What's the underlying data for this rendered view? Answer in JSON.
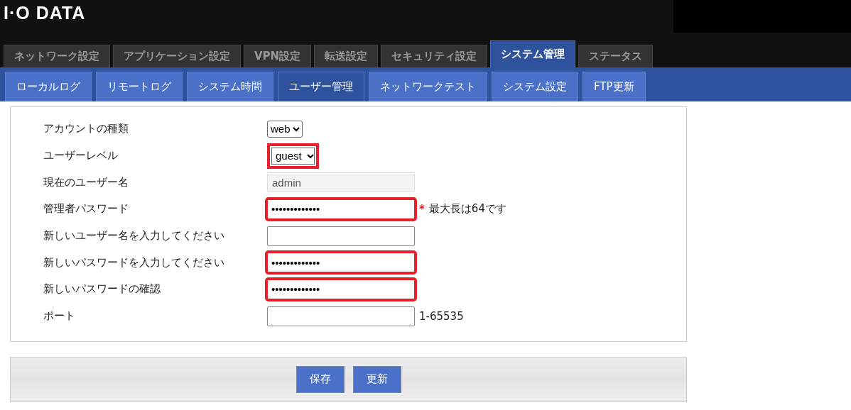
{
  "header": {
    "logo": "I·O DATA"
  },
  "tabs": [
    {
      "label": "ネットワーク設定",
      "selected": false
    },
    {
      "label": "アプリケーション設定",
      "selected": false
    },
    {
      "label": "VPN設定",
      "selected": false
    },
    {
      "label": "転送設定",
      "selected": false
    },
    {
      "label": "セキュリティ設定",
      "selected": false
    },
    {
      "label": "システム管理",
      "selected": true
    },
    {
      "label": "ステータス",
      "selected": false
    }
  ],
  "subtabs": [
    {
      "label": "ローカルログ",
      "selected": false
    },
    {
      "label": "リモートログ",
      "selected": false
    },
    {
      "label": "システム時間",
      "selected": false
    },
    {
      "label": "ユーザー管理",
      "selected": true
    },
    {
      "label": "ネットワークテスト",
      "selected": false
    },
    {
      "label": "システム設定",
      "selected": false
    },
    {
      "label": "FTP更新",
      "selected": false
    }
  ],
  "form": {
    "rows": [
      {
        "label": "アカウントの種類",
        "kind": "select",
        "value": "web",
        "highlighted": false
      },
      {
        "label": "ユーザーレベル",
        "kind": "select",
        "value": "guest",
        "highlighted": true
      },
      {
        "label": "現在のユーザー名",
        "kind": "readonly",
        "value": "admin",
        "highlighted": false
      },
      {
        "label": "管理者パスワード",
        "kind": "password",
        "value": "•••••••••••••",
        "highlighted": true,
        "required_mark": "*",
        "note": "最大長は64です"
      },
      {
        "label": "新しいユーザー名を入力してください",
        "kind": "text",
        "highlighted": false
      },
      {
        "label": "新しいパスワードを入力してください",
        "kind": "password",
        "value": "•••••••••••••",
        "highlighted": true
      },
      {
        "label": "新しいパスワードの確認",
        "kind": "password",
        "value": "•••••••••••••",
        "highlighted": true
      },
      {
        "label": "ポート",
        "kind": "text",
        "highlighted": false,
        "note": "1-65535"
      }
    ]
  },
  "buttons": [
    "保存",
    "更新"
  ]
}
